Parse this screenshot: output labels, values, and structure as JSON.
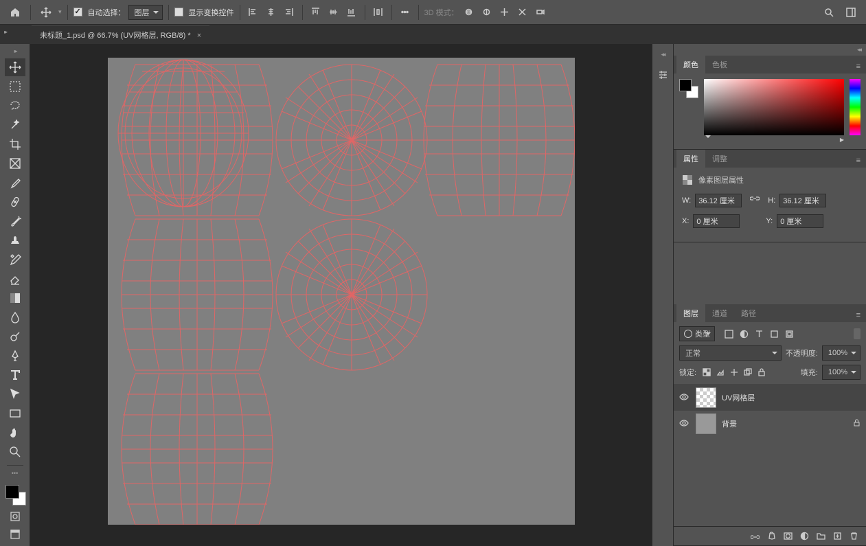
{
  "topbar": {
    "auto_select_label": "自动选择：",
    "auto_select_value": "图层",
    "show_transform_label": "显示变换控件",
    "mode_3d_label": "3D 模式："
  },
  "document": {
    "tab_title": "未标题_1.psd @ 66.7% (UV网格层, RGB/8) *"
  },
  "panels": {
    "color": {
      "tabs": [
        "颜色",
        "色板"
      ]
    },
    "properties": {
      "tabs": [
        "属性",
        "调整"
      ],
      "header": "像素图层属性",
      "w_label": "W:",
      "w_value": "36.12 厘米",
      "h_label": "H:",
      "h_value": "36.12 厘米",
      "x_label": "X:",
      "x_value": "0 厘米",
      "y_label": "Y:",
      "y_value": "0 厘米"
    },
    "layers": {
      "tabs": [
        "图层",
        "通道",
        "路径"
      ],
      "kind_label": "类型",
      "blend_mode": "正常",
      "opacity_label": "不透明度:",
      "opacity_value": "100%",
      "lock_label": "锁定:",
      "fill_label": "填充:",
      "fill_value": "100%",
      "items": [
        {
          "name": "UV网格层",
          "selected": true,
          "checker": true
        },
        {
          "name": "背景",
          "selected": false,
          "checker": false
        }
      ]
    }
  }
}
